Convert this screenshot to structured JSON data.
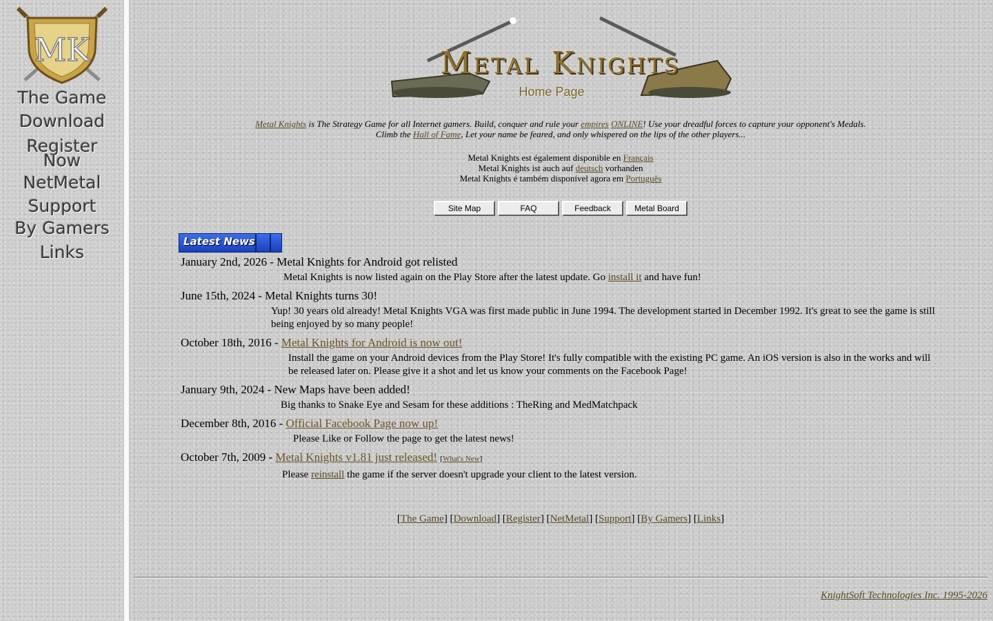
{
  "sidebar": {
    "logo_text": "MK",
    "nav": [
      "The Game",
      "Download",
      "Register",
      "Now",
      "NetMetal",
      "Support",
      "By Gamers",
      "Links"
    ]
  },
  "header": {
    "title": "Metal Knights",
    "subtitle": "Home Page"
  },
  "intro": {
    "game_link": "Metal Knights",
    "text1": " is The Strategy Game for all Internet gamers. Build, conquer and rule your ",
    "empires_link": "empires",
    "online_link": "ONLINE",
    "text2": "! Use your dreadful forces to capture your opponent's Medals.",
    "text3": "Climb the ",
    "hall_link": "Hall of Fame",
    "text4": ", Let your name be feared, and only whispered on the lips of the other players..."
  },
  "languages": [
    {
      "prefix": "Metal Knights est également disponible en ",
      "link": "Français",
      "suffix": ""
    },
    {
      "prefix": "Metal Knights ist auch auf ",
      "link": "deutsch",
      "suffix": " vorhanden"
    },
    {
      "prefix": "Metal Knights é também disponível agora em ",
      "link": "Português",
      "suffix": ""
    }
  ],
  "buttons": [
    "Site Map",
    "FAQ",
    "Feedback",
    "Metal Board"
  ],
  "news_badge": "Latest News",
  "news": [
    {
      "date": "January 2nd, 2026 - ",
      "headline": "Metal Knights for Android got relisted",
      "body_before": "Metal Knights is now listed again on the Play Store after the latest update. Go ",
      "body_link": "install it",
      "body_after": " and have fun!"
    },
    {
      "date": "June 15th, 2024 - ",
      "headline": "Metal Knights turns 30!",
      "body": "Yup! 30 years old already! Metal Knights VGA was first made public in June 1994. The development started in December 1992. It's great to see the game is still being enjoyed by so many people!"
    },
    {
      "date": "October 18th, 2016 - ",
      "headline_link": "Metal Knights for Android is now out!",
      "body": "Install the game on your Android devices from the Play Store! It's fully compatible with the existing PC game. An iOS version is also in the works and will be released later on. Please give it a shot and let us know your comments on the Facebook Page!"
    },
    {
      "date": "January 9th, 2024 - ",
      "headline": "New Maps have been added!",
      "body": "Big thanks to Snake Eye and Sesam for these additions : TheRing and MedMatchpack"
    },
    {
      "date": "December 8th, 2016 - ",
      "headline_link": "Official Facebook Page now up!",
      "body": "Please Like or Follow the page to get the latest news!"
    },
    {
      "date": "October 7th, 2009 - ",
      "headline_link": "Metal Knights v1.81 just released!",
      "whats_new": "What's New",
      "body_before": "Please ",
      "body_link": "reinstall",
      "body_after": " the game if the server doesn't upgrade your client to the latest version."
    }
  ],
  "footer_links": [
    "The Game",
    "Download",
    "Register",
    "NetMetal",
    "Support",
    "By Gamers",
    "Links"
  ],
  "copyright": "KnightSoft Technologies Inc. 1995-2026"
}
